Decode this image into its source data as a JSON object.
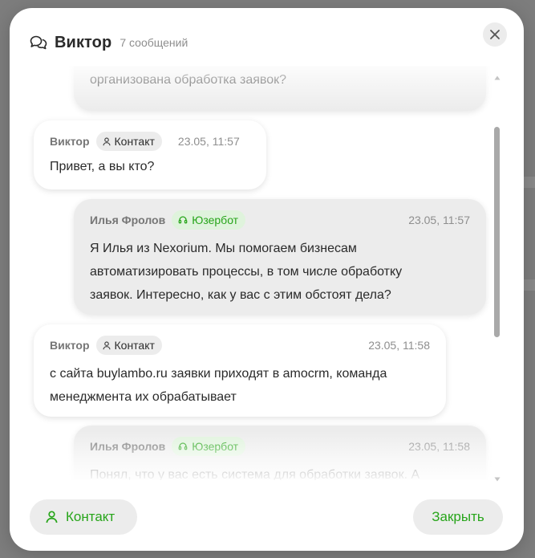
{
  "dialog": {
    "title": "Виктор",
    "subtitle": "7 сообщений"
  },
  "messages": [
    {
      "kind": "bot",
      "author": "",
      "badge": "",
      "time": "",
      "text_lines": [
        "",
        "организована обработка заявок?"
      ]
    },
    {
      "kind": "contact",
      "author": "Виктор",
      "badge": "Контакт",
      "time": "23.05, 11:57",
      "text_lines": [
        "Привет, а вы кто?"
      ]
    },
    {
      "kind": "bot",
      "author": "Илья Фролов",
      "badge": "Юзербот",
      "time": "23.05, 11:57",
      "text_lines": [
        "Я Илья из Nexorium. Мы помогаем бизнесам",
        "автоматизировать процессы, в том числе обработку",
        "заявок. Интересно, как у вас с этим обстоят дела?"
      ]
    },
    {
      "kind": "contact",
      "author": "Виктор",
      "badge": "Контакт",
      "time": "23.05, 11:58",
      "text_lines": [
        "с сайта buylambo.ru заявки приходят в amocrm, команда",
        "менеджмента их обрабатывает"
      ]
    },
    {
      "kind": "bot",
      "author": "Илья Фролов",
      "badge": "Юзербот",
      "time": "23.05, 11:58",
      "text_lines": [
        "Понял, что у вас есть система для обработки заявок. А"
      ]
    }
  ],
  "footer": {
    "contact_label": "Контакт",
    "close_label": "Закрыть"
  },
  "colors": {
    "accent_green": "#27a51a",
    "badge_green_bg": "#dff3dc",
    "bot_bubble": "#ececec",
    "overlay": "#7d7d7d"
  },
  "icons": [
    "chat-bubbles-icon",
    "close-icon",
    "person-icon",
    "headset-icon",
    "scroll-up-arrow-icon",
    "scroll-down-arrow-icon"
  ]
}
